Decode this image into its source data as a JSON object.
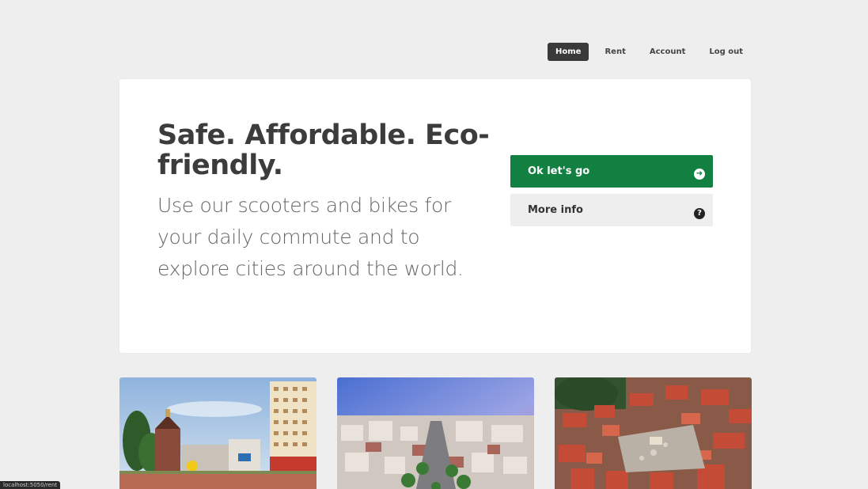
{
  "nav": {
    "items": [
      {
        "label": "Home",
        "active": true
      },
      {
        "label": "Rent",
        "active": false
      },
      {
        "label": "Account",
        "active": false
      },
      {
        "label": "Log out",
        "active": false
      }
    ]
  },
  "hero": {
    "title": "Safe. Affordable. Eco-friendly.",
    "subtitle": "Use our scooters and bikes for your daily commute and to explore cities around the world.",
    "primary_button": {
      "label": "Ok let's go",
      "icon": "arrow-circle-right-icon"
    },
    "secondary_button": {
      "label": "More info",
      "icon": "question-circle-icon"
    }
  },
  "cities": [
    {
      "image": "city-photo-1"
    },
    {
      "image": "city-photo-2"
    },
    {
      "image": "city-photo-3"
    }
  ],
  "status_bar": {
    "url": "localhost:5050/rent"
  },
  "colors": {
    "background": "#eeeeee",
    "primary": "#128040",
    "nav_active": "#3a3a3a",
    "card": "#ffffff"
  }
}
